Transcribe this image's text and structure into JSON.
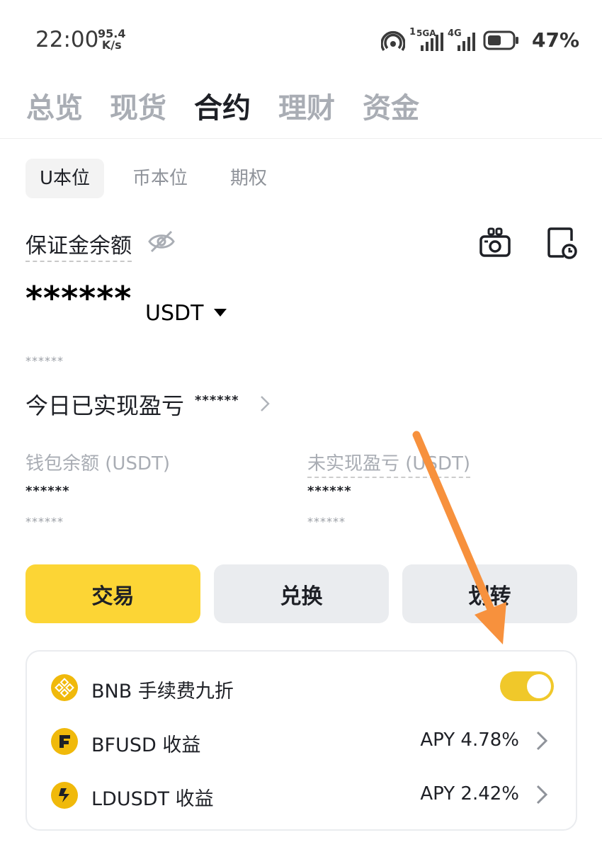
{
  "status_bar": {
    "time": "22:00",
    "net_speed_value": "95.4",
    "net_speed_unit": "K/s",
    "signal_1_label": "1",
    "signal_1_type": "5GA",
    "signal_2_type": "4G",
    "battery_percent": "47%"
  },
  "top_tabs": [
    {
      "label": "总览",
      "active": false
    },
    {
      "label": "现货",
      "active": false
    },
    {
      "label": "合约",
      "active": true
    },
    {
      "label": "理财",
      "active": false
    },
    {
      "label": "资金",
      "active": false
    }
  ],
  "sub_tabs": [
    {
      "label": "U本位",
      "active": true
    },
    {
      "label": "币本位",
      "active": false
    },
    {
      "label": "期权",
      "active": false
    }
  ],
  "account": {
    "margin_balance_label": "保证金余额",
    "margin_balance_value": "******",
    "currency": "USDT",
    "margin_balance_sub": "******",
    "today_pnl_label": "今日已实现盈亏",
    "today_pnl_value": "******",
    "wallet_balance_label": "钱包余额 (USDT)",
    "wallet_balance_value": "******",
    "wallet_balance_sub": "******",
    "unrealized_pnl_label": "未实现盈亏 (USDT)",
    "unrealized_pnl_value": "******",
    "unrealized_pnl_sub": "******"
  },
  "actions": {
    "trade": "交易",
    "convert": "兑换",
    "transfer": "划转"
  },
  "card": {
    "bnb_label": "BNB 手续费九折",
    "bnb_toggle_on": true,
    "bfusd_label": "BFUSD 收益",
    "bfusd_apy": "APY 4.78%",
    "ldusdt_label": "LDUSDT 收益",
    "ldusdt_apy": "APY 2.42%"
  },
  "colors": {
    "brand_yellow": "#fcd535",
    "annotation_orange": "#f7913d",
    "icon_gold": "#f0b90b"
  }
}
